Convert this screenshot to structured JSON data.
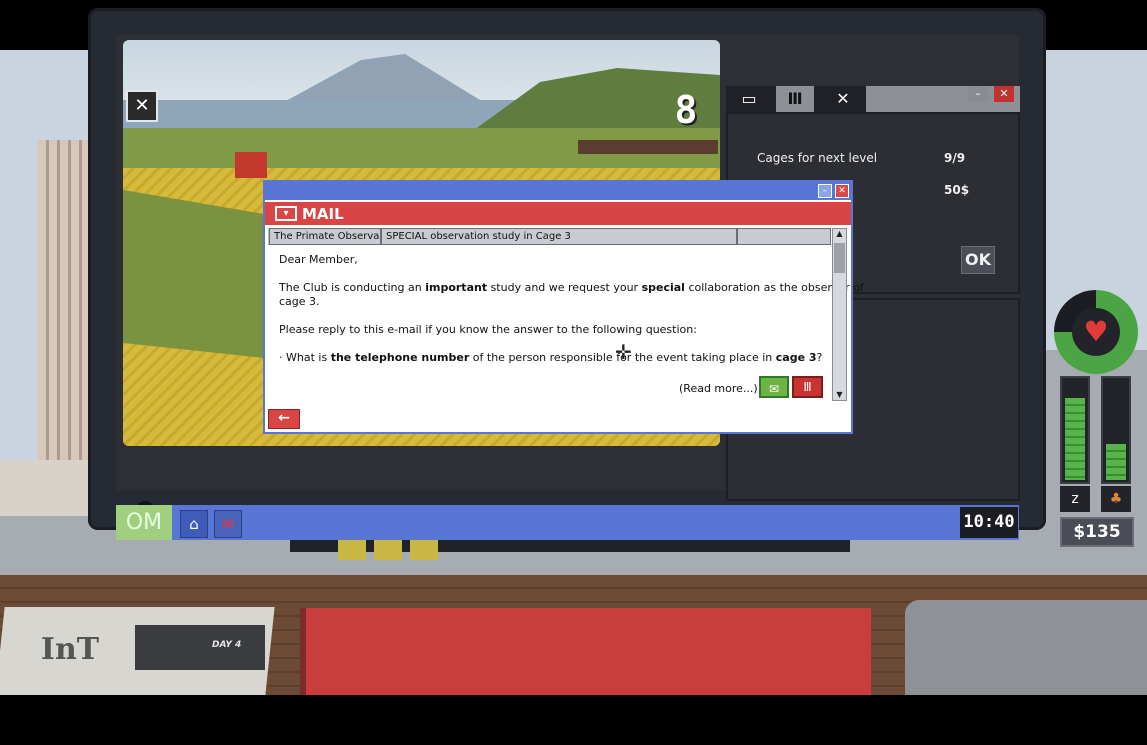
{
  "camera": {
    "cage_number": "8",
    "camera_icon": "camera-off-icon"
  },
  "panel": {
    "tabs": [
      "terminal-icon",
      "cage-icon",
      "close-icon"
    ],
    "cages_label": "Cages for next level",
    "cages_value": "9/9",
    "price_value": "50$",
    "ok_label": "OK"
  },
  "mail": {
    "title": "MAIL",
    "tabs": [
      "The Primate Observa...",
      "SPECIAL observation study in Cage 3",
      ""
    ],
    "greeting": "Dear Member,",
    "p1": {
      "a": "The Club is conducting an ",
      "b": "important",
      "c": " study and we request your ",
      "d": "special",
      "e": " collaboration as the observer of",
      "f": "cage 3."
    },
    "p2": "Please reply to this e-mail if you know the answer to the following question:",
    "p3": {
      "a": "· What is ",
      "b": "the telephone number",
      "c": " of the person responsible for the event taking place in ",
      "d": "cage 3",
      "e": "?"
    },
    "read_more": "(Read more...)"
  },
  "taskbar": {
    "start_label": "OM",
    "clock": "10:40"
  },
  "status": {
    "health_fraction": 0.75,
    "sleep_fraction": 0.85,
    "food_fraction": 0.37,
    "money": "$135"
  },
  "desk": {
    "newspaper_logo": "InT",
    "day_label": "DAY 4"
  },
  "colors": {
    "taskbar_blue": "#5877d4",
    "mail_red": "#d94545",
    "meter_green": "#58b34a"
  }
}
